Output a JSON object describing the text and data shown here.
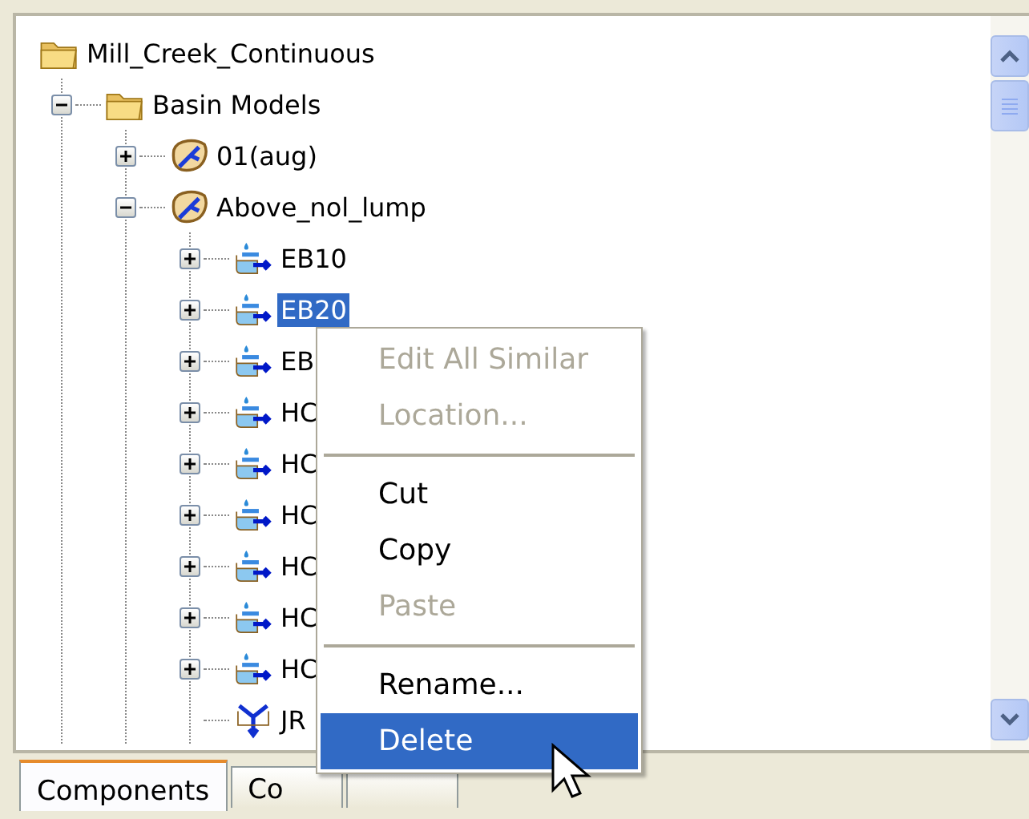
{
  "tree": [
    {
      "label": "Mill_Creek_Continuous",
      "kind": "folder",
      "selected": false,
      "children": [
        {
          "label": "Basin Models",
          "kind": "folder",
          "expanded": true,
          "selected": false,
          "children": [
            {
              "label": "01(aug)",
              "kind": "basin",
              "expanded": false,
              "selected": false
            },
            {
              "label": "Above_nol_lump",
              "kind": "basin",
              "expanded": true,
              "selected": false,
              "children": [
                {
                  "label": "EB10",
                  "kind": "subbasin",
                  "expanded": false,
                  "selected": false
                },
                {
                  "label": "EB20",
                  "kind": "subbasin",
                  "expanded": false,
                  "selected": true
                },
                {
                  "label": "EB",
                  "kind": "subbasin",
                  "expanded": false,
                  "selected": false
                },
                {
                  "label": "HC",
                  "kind": "subbasin",
                  "expanded": false,
                  "selected": false
                },
                {
                  "label": "HC",
                  "kind": "subbasin",
                  "expanded": false,
                  "selected": false
                },
                {
                  "label": "HC",
                  "kind": "subbasin",
                  "expanded": false,
                  "selected": false
                },
                {
                  "label": "HC",
                  "kind": "subbasin",
                  "expanded": false,
                  "selected": false
                },
                {
                  "label": "HC",
                  "kind": "subbasin",
                  "expanded": false,
                  "selected": false
                },
                {
                  "label": "HC",
                  "kind": "subbasin",
                  "expanded": false,
                  "selected": false
                },
                {
                  "label": "JR",
                  "kind": "junction",
                  "selected": false
                }
              ]
            }
          ]
        }
      ]
    }
  ],
  "tabs": [
    {
      "label": "Components",
      "selected": true
    },
    {
      "label": "Co",
      "selected": false
    },
    {
      "selected": false
    }
  ],
  "context_menu": [
    {
      "kind": "item",
      "label": "Edit All Similar",
      "disabled": true,
      "selected": false
    },
    {
      "kind": "item",
      "label": "Location...",
      "disabled": true,
      "selected": false
    },
    {
      "kind": "separator"
    },
    {
      "kind": "item",
      "label": "Cut",
      "disabled": false,
      "selected": false
    },
    {
      "kind": "item",
      "label": "Copy",
      "disabled": false,
      "selected": false
    },
    {
      "kind": "item",
      "label": "Paste",
      "disabled": true,
      "selected": false
    },
    {
      "kind": "separator"
    },
    {
      "kind": "item",
      "label": "Rename...",
      "disabled": false,
      "selected": false
    },
    {
      "kind": "item",
      "label": "Delete",
      "disabled": false,
      "selected": true
    }
  ]
}
